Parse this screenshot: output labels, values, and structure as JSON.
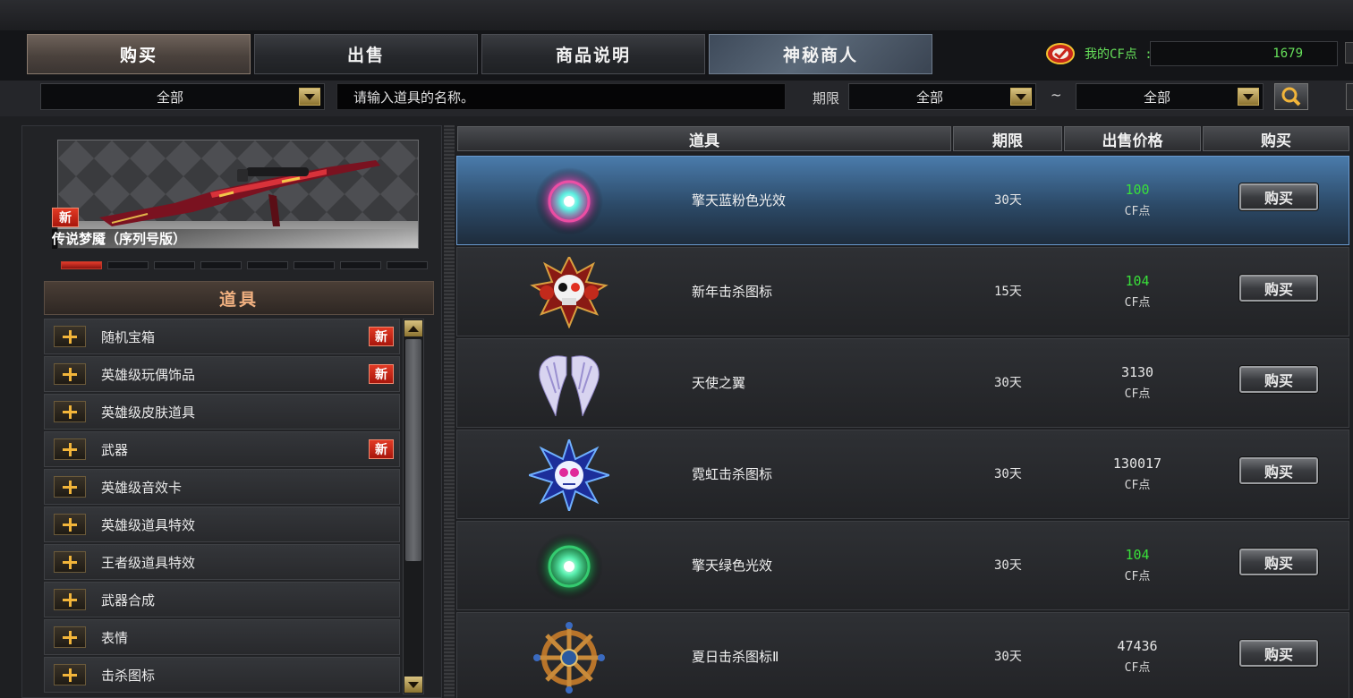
{
  "tabs": [
    {
      "label": "购买",
      "active": true
    },
    {
      "label": "出售",
      "active": false
    },
    {
      "label": "商品说明",
      "active": false
    },
    {
      "label": "神秘商人",
      "active": false
    }
  ],
  "cf_points": {
    "label": "我的CF点 :",
    "value": "1679"
  },
  "filters": {
    "category": "全部",
    "search_placeholder": "请输入道具的名称。",
    "period_label": "期限",
    "period_from": "全部",
    "tilde": "~",
    "period_to": "全部"
  },
  "banner": {
    "badge": "新",
    "title": "传说梦魇（序列号版）",
    "page_dots": 8,
    "active_dot": 0
  },
  "category_header": "道具",
  "categories": [
    {
      "label": "随机宝箱",
      "new": "新"
    },
    {
      "label": "英雄级玩偶饰品",
      "new": "新"
    },
    {
      "label": "英雄级皮肤道具",
      "new": ""
    },
    {
      "label": "武器",
      "new": "新"
    },
    {
      "label": "英雄级音效卡",
      "new": ""
    },
    {
      "label": "英雄级道具特效",
      "new": ""
    },
    {
      "label": "王者级道具特效",
      "new": ""
    },
    {
      "label": "武器合成",
      "new": ""
    },
    {
      "label": "表情",
      "new": ""
    },
    {
      "label": "击杀图标",
      "new": ""
    }
  ],
  "table": {
    "columns": [
      "道具",
      "期限",
      "出售价格",
      "购买"
    ],
    "rows": [
      {
        "icon": "glow-effect-blue-pink-icon",
        "name": "擎天蓝粉色光效",
        "period": "30天",
        "price": "100",
        "unit": "CF点",
        "price_color": "#39e03a",
        "buy": "购买",
        "selected": true
      },
      {
        "icon": "skull-kill-icon",
        "name": "新年击杀图标",
        "period": "15天",
        "price": "104",
        "unit": "CF点",
        "price_color": "#39e03a",
        "buy": "购买",
        "selected": false
      },
      {
        "icon": "angel-wings-icon",
        "name": "天使之翼",
        "period": "30天",
        "price": "3130",
        "unit": "CF点",
        "price_color": "#e6e6e6",
        "buy": "购买",
        "selected": false
      },
      {
        "icon": "neon-skull-kill-icon",
        "name": "霓虹击杀图标",
        "period": "30天",
        "price": "130017",
        "unit": "CF点",
        "price_color": "#e6e6e6",
        "buy": "购买",
        "selected": false
      },
      {
        "icon": "glow-effect-green-icon",
        "name": "擎天绿色光效",
        "period": "30天",
        "price": "104",
        "unit": "CF点",
        "price_color": "#39e03a",
        "buy": "购买",
        "selected": false
      },
      {
        "icon": "ship-wheel-kill-icon",
        "name": "夏日击杀图标Ⅱ",
        "period": "30天",
        "price": "47436",
        "unit": "CF点",
        "price_color": "#e6e6e6",
        "buy": "购买",
        "selected": false
      }
    ]
  }
}
